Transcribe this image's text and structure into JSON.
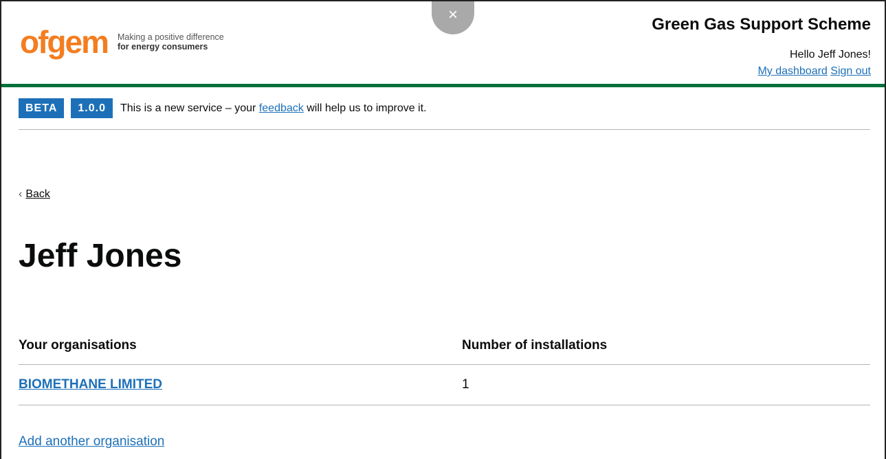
{
  "header": {
    "logo_word": "ofgem",
    "tagline_line1": "Making a positive difference",
    "tagline_line2": "for energy consumers",
    "close_label": "×",
    "service_name": "Green Gas Support Scheme",
    "greeting": "Hello Jeff Jones!",
    "dashboard_link": "My dashboard",
    "signout_link": "Sign out"
  },
  "banner": {
    "phase_tag": "BETA",
    "version_tag": "1.0.0",
    "text_before": "This is a new service – your ",
    "feedback_link": "feedback",
    "text_after": " will help us to improve it."
  },
  "nav": {
    "back_chevron": "‹",
    "back_label": "Back"
  },
  "page": {
    "title": "Jeff Jones"
  },
  "table": {
    "headers": [
      "Your organisations",
      "Number of installations"
    ],
    "rows": [
      {
        "organisation": "BIOMETHANE LIMITED",
        "installations": "1"
      }
    ]
  },
  "actions": {
    "add_organisation": "Add another organisation"
  },
  "colors": {
    "brand_orange": "#f47d20",
    "header_green": "#00703c",
    "link_blue": "#1d70b8"
  }
}
